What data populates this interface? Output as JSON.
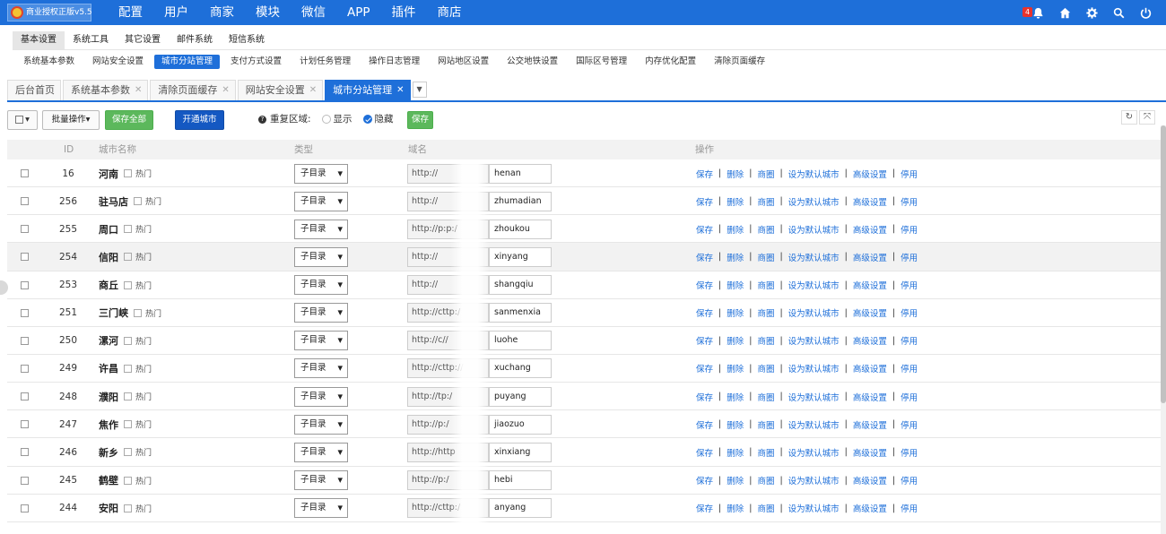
{
  "header": {
    "logo_text": "商业授权正版v5.5",
    "nav": [
      "配置",
      "用户",
      "商家",
      "模块",
      "微信",
      "APP",
      "插件",
      "商店"
    ],
    "notification_count": "4"
  },
  "subnav": [
    "基本设置",
    "系统工具",
    "其它设置",
    "邮件系统",
    "短信系统"
  ],
  "thirdnav": [
    "系统基本参数",
    "网站安全设置",
    "城市分站管理",
    "支付方式设置",
    "计划任务管理",
    "操作日志管理",
    "网站地区设置",
    "公交地铁设置",
    "国际区号管理",
    "内存优化配置",
    "清除页面缓存"
  ],
  "tabs": [
    "后台首页",
    "系统基本参数",
    "清除页面缓存",
    "网站安全设置",
    "城市分站管理"
  ],
  "toolbar": {
    "batch_label": "批量操作",
    "save_all_label": "保存全部",
    "open_city_label": "开通城市",
    "repeat_label": "重复区域:",
    "show_label": "显示",
    "hide_label": "隐藏",
    "save_label": "保存"
  },
  "table": {
    "headers": {
      "id": "ID",
      "name": "城市名称",
      "type": "类型",
      "domain": "域名",
      "ops": "操作"
    },
    "hot_label": "热门",
    "type_value": "子目录",
    "ops": [
      "保存",
      "删除",
      "商圈",
      "设为默认城市",
      "高级设置",
      "停用"
    ],
    "rows": [
      {
        "id": "16",
        "name": "河南",
        "prefix": "http://",
        "domain": "henan"
      },
      {
        "id": "256",
        "name": "驻马店",
        "prefix": "http://",
        "domain": "zhumadian"
      },
      {
        "id": "255",
        "name": "周口",
        "prefix": "http://p:p:/",
        "domain": "zhoukou"
      },
      {
        "id": "254",
        "name": "信阳",
        "prefix": "http://",
        "domain": "xinyang"
      },
      {
        "id": "253",
        "name": "商丘",
        "prefix": "http://",
        "domain": "shangqiu"
      },
      {
        "id": "251",
        "name": "三门峡",
        "prefix": "http://cttp:/",
        "domain": "sanmenxia"
      },
      {
        "id": "250",
        "name": "漯河",
        "prefix": "http://c//",
        "domain": "luohe"
      },
      {
        "id": "249",
        "name": "许昌",
        "prefix": "http://cttp://",
        "domain": "xuchang"
      },
      {
        "id": "248",
        "name": "濮阳",
        "prefix": "http://tp:/",
        "domain": "puyang"
      },
      {
        "id": "247",
        "name": "焦作",
        "prefix": "http://p:/",
        "domain": "jiaozuo"
      },
      {
        "id": "246",
        "name": "新乡",
        "prefix": "http://http",
        "domain": "xinxiang"
      },
      {
        "id": "245",
        "name": "鹤壁",
        "prefix": "http://p:/",
        "domain": "hebi"
      },
      {
        "id": "244",
        "name": "安阳",
        "prefix": "http://cttp:/",
        "domain": "anyang"
      }
    ]
  }
}
